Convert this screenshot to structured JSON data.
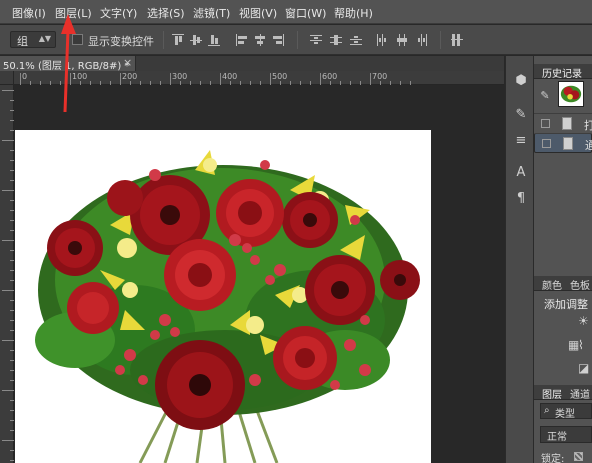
{
  "menu": [
    {
      "label": "图像(I)"
    },
    {
      "label": "图层(L)"
    },
    {
      "label": "文字(Y)"
    },
    {
      "label": "选择(S)"
    },
    {
      "label": "滤镜(T)"
    },
    {
      "label": "视图(V)"
    },
    {
      "label": "窗口(W)"
    },
    {
      "label": "帮助(H)"
    }
  ],
  "options": {
    "select_value": "组",
    "show_transform_label": "显示变换控件"
  },
  "document": {
    "tab_label": "50.1% (图层 1, RGB/8#) *",
    "close_symbol": "×"
  },
  "ruler": {
    "h_labels": [
      "0",
      "100",
      "200",
      "300",
      "400",
      "500",
      "600",
      "700"
    ]
  },
  "panels": {
    "history_tab": "历史记录",
    "history_rows": [
      {
        "text": "打"
      },
      {
        "text": "通"
      }
    ],
    "color_tab": "颜色",
    "swatches_tab": "色板",
    "adjust_title": "添加调整",
    "layers_tab": "图层",
    "channels_tab": "通道",
    "layers_kind": "类型",
    "blend_mode": "正常",
    "lock_label": "锁定:"
  },
  "annotation": {
    "arrow_color": "#e8302a"
  }
}
